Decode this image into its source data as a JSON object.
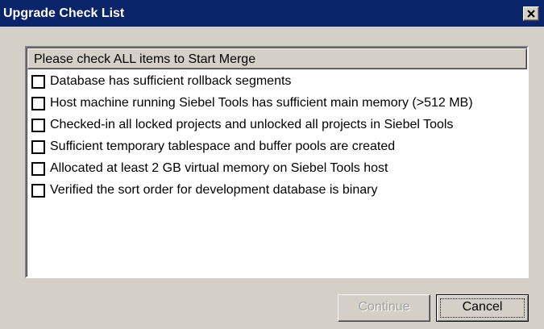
{
  "window": {
    "title": "Upgrade Check List",
    "close_icon": "close-icon"
  },
  "checklist": {
    "header": "Please check ALL items to Start Merge",
    "items": [
      {
        "label": "Database has sufficient rollback segments",
        "checked": false
      },
      {
        "label": "Host machine running Siebel Tools has sufficient main memory (>512 MB)",
        "checked": false
      },
      {
        "label": "Checked-in all locked projects and unlocked all projects in Siebel Tools",
        "checked": false
      },
      {
        "label": "Sufficient temporary tablespace and buffer pools are created",
        "checked": false
      },
      {
        "label": "Allocated at least 2 GB virtual memory on Siebel Tools host",
        "checked": false
      },
      {
        "label": "Verified the sort order for development database is binary",
        "checked": false
      }
    ]
  },
  "buttons": {
    "continue_label": "Continue",
    "continue_enabled": false,
    "cancel_label": "Cancel"
  },
  "colors": {
    "titlebar": "#0a246a",
    "face": "#d4d0c8",
    "disabled_text": "#a0a0a0"
  }
}
